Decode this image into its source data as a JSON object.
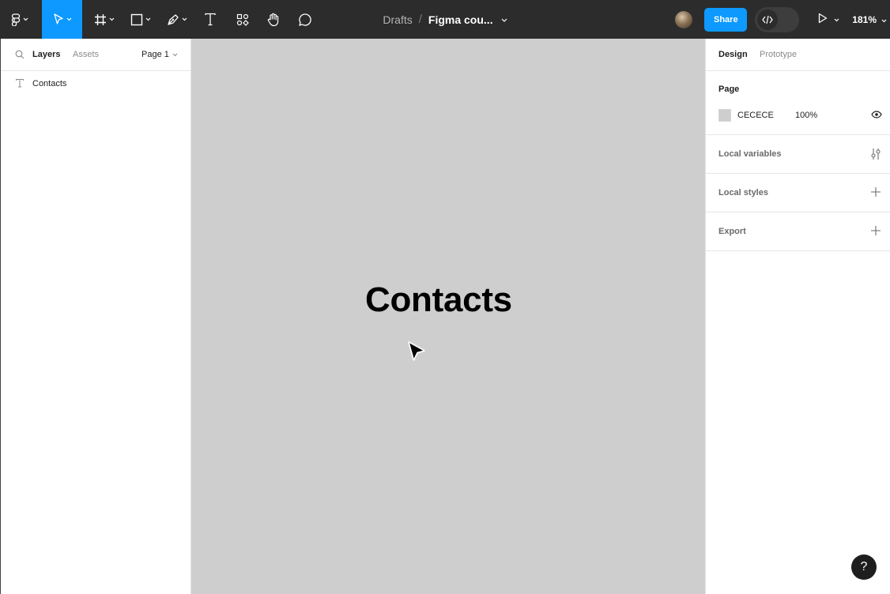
{
  "toolbar": {
    "tools": [
      {
        "name": "main-menu",
        "icon": "figma-logo-icon"
      },
      {
        "name": "move",
        "icon": "move-cursor-icon",
        "active": true
      },
      {
        "name": "frame",
        "icon": "frame-hash-icon"
      },
      {
        "name": "shape",
        "icon": "rectangle-icon"
      },
      {
        "name": "pen",
        "icon": "pen-icon"
      },
      {
        "name": "text",
        "icon": "text-icon"
      },
      {
        "name": "resources",
        "icon": "components-icon"
      },
      {
        "name": "hand",
        "icon": "hand-icon"
      },
      {
        "name": "comment",
        "icon": "comment-bubble-icon"
      }
    ],
    "breadcrumb": {
      "folder": "Drafts",
      "separator": "/",
      "file": "Figma cou..."
    },
    "share_label": "Share",
    "zoom": "181%",
    "accent": "#0d99ff"
  },
  "left_panel": {
    "tabs": {
      "layers": "Layers",
      "assets": "Assets"
    },
    "page_selector": "Page 1",
    "layers": [
      {
        "type": "text",
        "icon": "text-layer-icon",
        "name": "Contacts"
      }
    ]
  },
  "canvas": {
    "background": "#cecece",
    "text": "Contacts"
  },
  "right_panel": {
    "tabs": {
      "design": "Design",
      "prototype": "Prototype"
    },
    "page": {
      "title": "Page",
      "color_hex": "CECECE",
      "opacity": "100%"
    },
    "sections": [
      {
        "label": "Local variables",
        "icon": "variables-sliders-icon"
      },
      {
        "label": "Local styles",
        "icon": "plus-icon"
      },
      {
        "label": "Export",
        "icon": "plus-icon"
      }
    ]
  },
  "help_label": "?"
}
